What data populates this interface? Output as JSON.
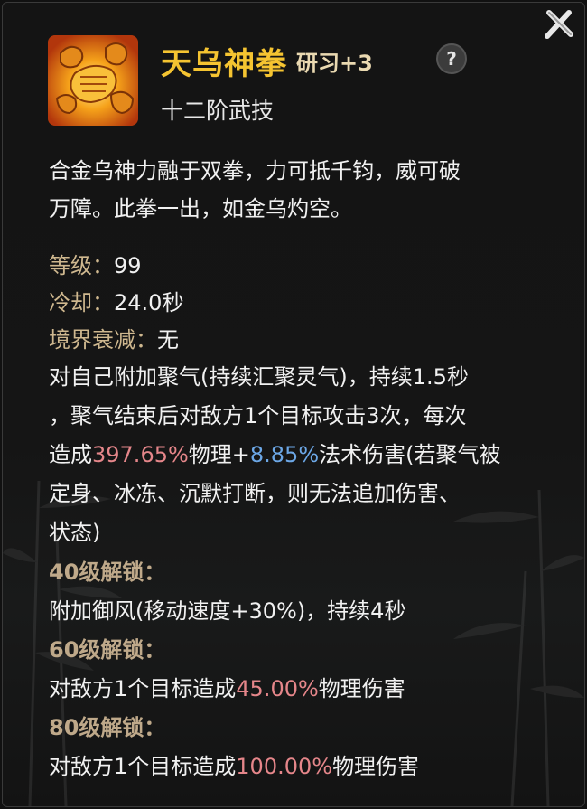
{
  "skill": {
    "name": "天乌神拳",
    "study": "研习+3",
    "help": "?",
    "rank": "十二阶武技"
  },
  "description": {
    "line1": "合金乌神力融于双拳，力可抵千钧，威可破",
    "line2": "万障。此拳一出，如金乌灼空。"
  },
  "stats": {
    "level_label": "等级：",
    "level_value": "99",
    "cooldown_label": "冷却：",
    "cooldown_value": "24.0秒",
    "decay_label": "境界衰减：",
    "decay_value": "无"
  },
  "effect": {
    "line1": "对自己附加聚气(持续汇聚灵气)，持续1.5秒",
    "line2": "，聚气结束后对敌方1个目标攻击3次，每次",
    "line3_a": "造成",
    "line3_phys": "397.65%",
    "line3_b": "物理+",
    "line3_magic": "8.85%",
    "line3_c": "法术伤害(若聚气被",
    "line4": "定身、冰冻、沉默打断，则无法追加伤害、",
    "line5": "状态)"
  },
  "unlocks": [
    {
      "title": "40级解锁：",
      "text": "附加御风(移动速度+30%)，持续4秒"
    },
    {
      "title": "60级解锁：",
      "text_a": "对敌方1个目标造成",
      "value": "45.00%",
      "text_b": "物理伤害"
    },
    {
      "title": "80级解锁：",
      "text_a": "对敌方1个目标造成",
      "value": "100.00%",
      "text_b": "物理伤害"
    }
  ],
  "colors": {
    "name": "#f5c431",
    "physical": "#e5868a",
    "magic": "#6ca7e6",
    "label": "#cfb88f"
  },
  "icons": {
    "close": "close-x-icon",
    "help": "question-icon",
    "skill": "fist-skill-icon"
  }
}
